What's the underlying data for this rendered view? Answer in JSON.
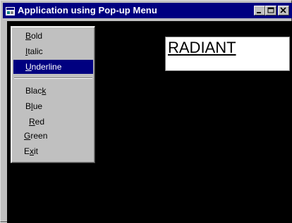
{
  "window": {
    "title": "Application using Pop-up Menu"
  },
  "popup_menu": {
    "items": [
      {
        "label": "Bold",
        "access_key": "B"
      },
      {
        "label": "Italic",
        "access_key": "I"
      },
      {
        "label": "Underline",
        "access_key": "U",
        "selected": true
      },
      {
        "label": "Black",
        "access_key": "k"
      },
      {
        "label": "Blue",
        "access_key": "l"
      },
      {
        "label": "Red",
        "access_key": "R"
      },
      {
        "label": "Green",
        "access_key": "G"
      },
      {
        "label": "Exit",
        "access_key": "x"
      }
    ]
  },
  "label_box": {
    "text": "RADIANT"
  },
  "colors": {
    "titlebar": "#000080",
    "selection": "#000080",
    "client_background": "#000000",
    "menu_face": "#c0c0c0"
  },
  "icons": [
    "app-icon",
    "minimize-icon",
    "maximize-icon",
    "close-icon"
  ]
}
